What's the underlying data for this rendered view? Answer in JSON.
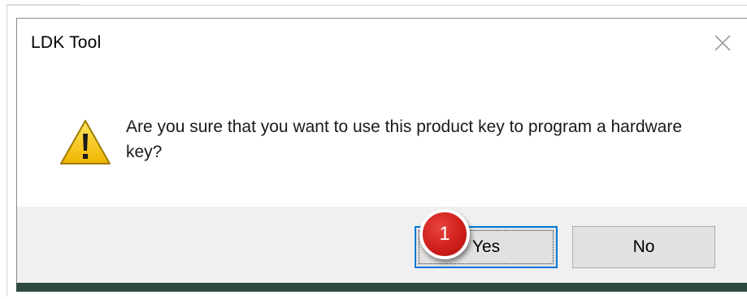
{
  "dialog": {
    "title": "LDK Tool",
    "message": "Are you sure that you want to use this product key to program a hardware key?",
    "icon": "warning-icon",
    "buttons": {
      "yes_label": "Yes",
      "no_label": "No"
    }
  },
  "annotation": {
    "step_number": "1",
    "color": "#d0211c"
  },
  "colors": {
    "button_focus_border": "#0078d7",
    "button_area_bg": "#f0f0f0",
    "warning_yellow": "#f5c400"
  }
}
